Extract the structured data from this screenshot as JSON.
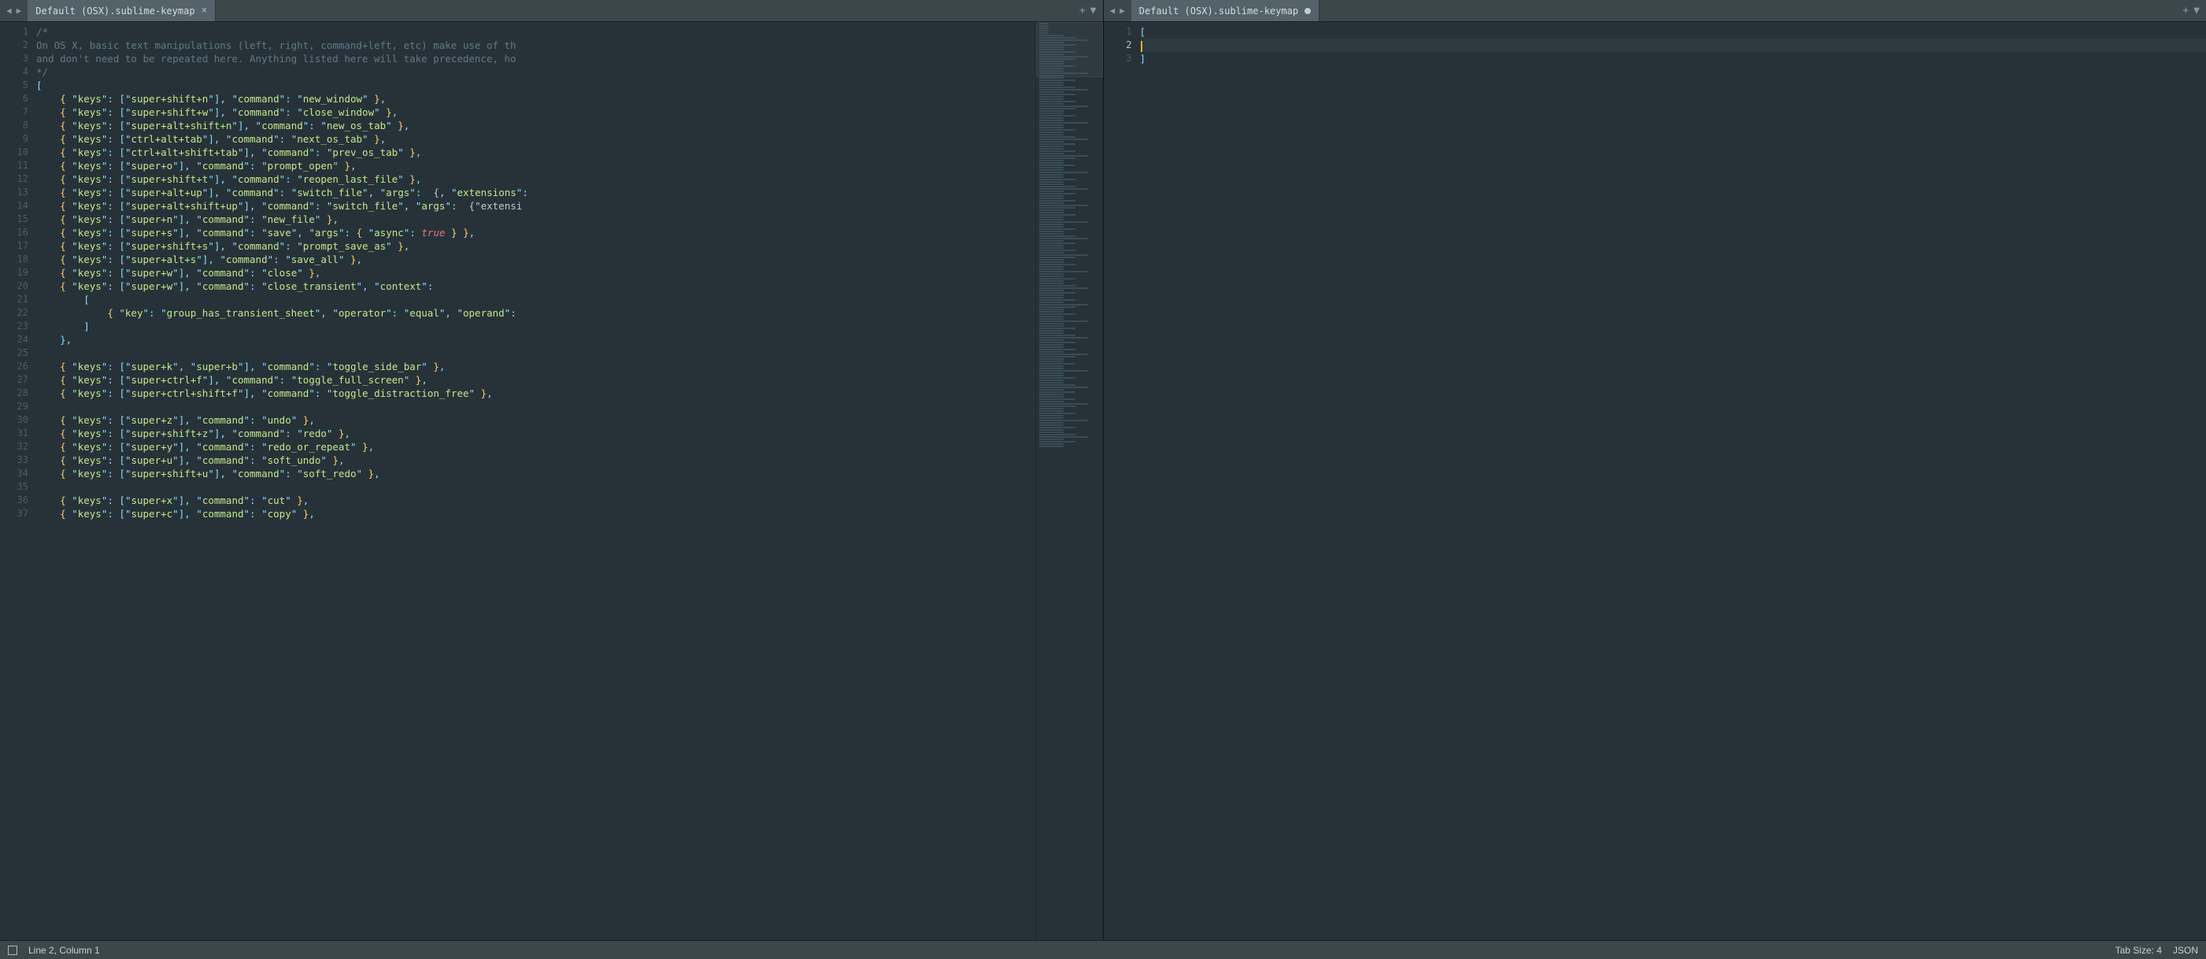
{
  "left": {
    "tab_title": "Default (OSX).sublime-keymap",
    "tab_dirty": false,
    "line_numbers": [
      1,
      2,
      3,
      4,
      5,
      6,
      7,
      8,
      9,
      10,
      11,
      12,
      13,
      14,
      15,
      16,
      17,
      18,
      19,
      20,
      21,
      22,
      23,
      24,
      25,
      26,
      27,
      28,
      29,
      30,
      31,
      32,
      33,
      34,
      35,
      36,
      37
    ],
    "lines": [
      {
        "t": "cmt",
        "c": "/*"
      },
      {
        "t": "cmt",
        "c": "On OS X, basic text manipulations (left, right, command+left, etc) make use of th"
      },
      {
        "t": "cmt",
        "c": "and don't need to be repeated here. Anything listed here will take precedence, ho"
      },
      {
        "t": "cmt",
        "c": "*/"
      },
      {
        "t": "plain",
        "c": "["
      },
      {
        "t": "kv",
        "i": 4,
        "keys": [
          "super+shift+n"
        ],
        "cmd": "new_window"
      },
      {
        "t": "kv",
        "i": 4,
        "keys": [
          "super+shift+w"
        ],
        "cmd": "close_window"
      },
      {
        "t": "kv",
        "i": 4,
        "keys": [
          "super+alt+shift+n"
        ],
        "cmd": "new_os_tab"
      },
      {
        "t": "kv",
        "i": 4,
        "keys": [
          "ctrl+alt+tab"
        ],
        "cmd": "next_os_tab"
      },
      {
        "t": "kv",
        "i": 4,
        "keys": [
          "ctrl+alt+shift+tab"
        ],
        "cmd": "prev_os_tab"
      },
      {
        "t": "kv",
        "i": 4,
        "keys": [
          "super+o"
        ],
        "cmd": "prompt_open"
      },
      {
        "t": "kv",
        "i": 4,
        "keys": [
          "super+shift+t"
        ],
        "cmd": "reopen_last_file"
      },
      {
        "t": "kvex",
        "i": 4,
        "keys": [
          "super+alt+up"
        ],
        "cmd": "switch_file",
        "tail": ", \"args\": {\"extensions\":"
      },
      {
        "t": "kvex",
        "i": 4,
        "keys": [
          "super+alt+shift+up"
        ],
        "cmd": "switch_file",
        "tail": ", \"args\": {\"extensi"
      },
      {
        "t": "kv",
        "i": 4,
        "keys": [
          "super+n"
        ],
        "cmd": "new_file"
      },
      {
        "t": "kvasync",
        "i": 4,
        "keys": [
          "super+s"
        ],
        "cmd": "save"
      },
      {
        "t": "kv",
        "i": 4,
        "keys": [
          "super+shift+s"
        ],
        "cmd": "prompt_save_as"
      },
      {
        "t": "kv",
        "i": 4,
        "keys": [
          "super+alt+s"
        ],
        "cmd": "save_all"
      },
      {
        "t": "kv",
        "i": 4,
        "keys": [
          "super+w"
        ],
        "cmd": "close"
      },
      {
        "t": "kvctx",
        "i": 4,
        "keys": [
          "super+w"
        ],
        "cmd": "close_transient"
      },
      {
        "t": "raw",
        "i": 8,
        "c": "["
      },
      {
        "t": "ctxline",
        "i": 12
      },
      {
        "t": "raw",
        "i": 8,
        "c": "]"
      },
      {
        "t": "raw",
        "i": 4,
        "c": "},"
      },
      {
        "t": "blank"
      },
      {
        "t": "kv2",
        "i": 4,
        "keys": [
          "super+k",
          "super+b"
        ],
        "cmd": "toggle_side_bar"
      },
      {
        "t": "kv",
        "i": 4,
        "keys": [
          "super+ctrl+f"
        ],
        "cmd": "toggle_full_screen"
      },
      {
        "t": "kv",
        "i": 4,
        "keys": [
          "super+ctrl+shift+f"
        ],
        "cmd": "toggle_distraction_free"
      },
      {
        "t": "blank"
      },
      {
        "t": "kv",
        "i": 4,
        "keys": [
          "super+z"
        ],
        "cmd": "undo"
      },
      {
        "t": "kv",
        "i": 4,
        "keys": [
          "super+shift+z"
        ],
        "cmd": "redo"
      },
      {
        "t": "kv",
        "i": 4,
        "keys": [
          "super+y"
        ],
        "cmd": "redo_or_repeat"
      },
      {
        "t": "kv",
        "i": 4,
        "keys": [
          "super+u"
        ],
        "cmd": "soft_undo"
      },
      {
        "t": "kv",
        "i": 4,
        "keys": [
          "super+shift+u"
        ],
        "cmd": "soft_redo"
      },
      {
        "t": "blank"
      },
      {
        "t": "kv",
        "i": 4,
        "keys": [
          "super+x"
        ],
        "cmd": "cut"
      },
      {
        "t": "kv",
        "i": 4,
        "keys": [
          "super+c"
        ],
        "cmd": "copy"
      }
    ]
  },
  "right": {
    "tab_title": "Default (OSX).sublime-keymap",
    "tab_dirty": true,
    "line_numbers": [
      1,
      2,
      3
    ],
    "active_line": 2,
    "lines": [
      {
        "t": "plain",
        "c": "["
      },
      {
        "t": "empty_active"
      },
      {
        "t": "plain",
        "c": "]"
      }
    ]
  },
  "status": {
    "position": "Line 2, Column 1",
    "tab_size": "Tab Size: 4",
    "syntax": "JSON"
  },
  "icons": {
    "nav_prev": "◀",
    "nav_next": "▶",
    "close": "×",
    "plus": "+",
    "dropdown": "▼"
  },
  "context_line": {
    "key": "group_has_transient_sheet",
    "operator": "equal",
    "operand_label": "operand"
  }
}
